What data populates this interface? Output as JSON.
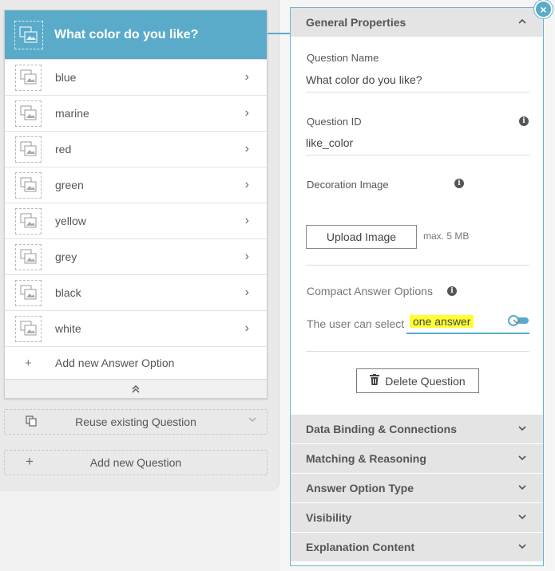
{
  "question_card": {
    "title": "What color do you like?",
    "answers": [
      {
        "label": "blue"
      },
      {
        "label": "marine"
      },
      {
        "label": "red"
      },
      {
        "label": "green"
      },
      {
        "label": "yellow"
      },
      {
        "label": "grey"
      },
      {
        "label": "black"
      },
      {
        "label": "white"
      }
    ],
    "add_answer_label": "Add new Answer Option",
    "add_answer_icon": "+",
    "collapse_icon": "⌃"
  },
  "left_actions": {
    "reuse_label": "Reuse existing Question",
    "add_label": "Add new Question",
    "add_icon": "+"
  },
  "panel": {
    "close_icon": "×",
    "general": {
      "title": "General Properties",
      "question_name_label": "Question Name",
      "question_name_value": "What color do you like?",
      "question_id_label": "Question ID",
      "question_id_value": "like_color",
      "decoration_image_label": "Decoration Image",
      "upload_button": "Upload Image",
      "max_size": "max. 5 MB",
      "compact_label": "Compact Answer Options",
      "compact_enabled": false,
      "selection_label": "The user can select",
      "selection_value": "one answer",
      "delete_button": "Delete Question"
    },
    "sections": [
      {
        "title": "Data Binding & Connections"
      },
      {
        "title": "Matching & Reasoning"
      },
      {
        "title": "Answer Option Type"
      },
      {
        "title": "Visibility"
      },
      {
        "title": "Explanation Content"
      }
    ]
  },
  "colors": {
    "accent": "#5aabc9",
    "highlight": "#ffff33",
    "section_bg": "#e4e4e4"
  }
}
